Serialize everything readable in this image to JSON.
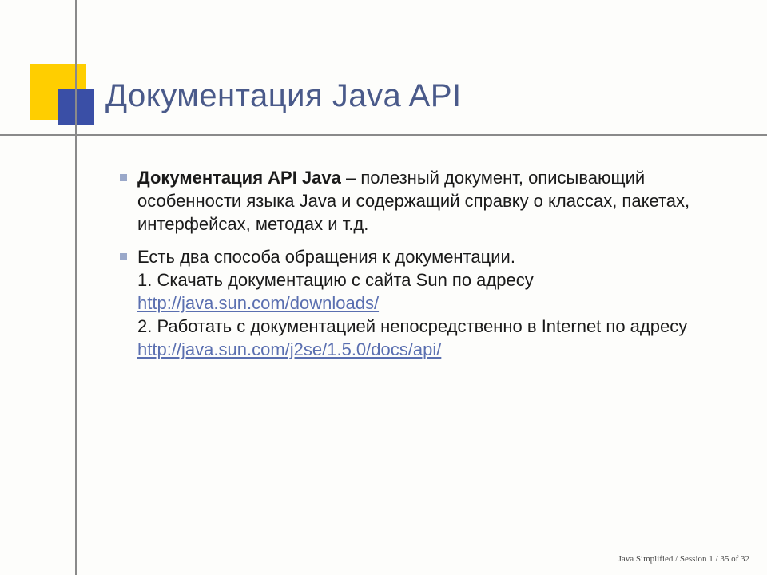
{
  "title": "Документация Java API",
  "bullets": [
    {
      "bold_lead": "Документация API Java",
      "rest": " – полезный документ, описывающий особенности языка Java и содержащий справку о классах, пакетах, интерфейсах, методах и т.д."
    },
    {
      "line1": "Есть два способа обращения к документации.",
      "line2": "1. Скачать документацию с сайта Sun по адресу",
      "link1": "http://java.sun.com/downloads/",
      "line3": "2. Работать с документацией непосредственно в Internet по адресу",
      "link2": "http://java.sun.com/j2se/1.5.0/docs/api/"
    }
  ],
  "footer": "Java Simplified /  Session 1 / 35 of 32"
}
